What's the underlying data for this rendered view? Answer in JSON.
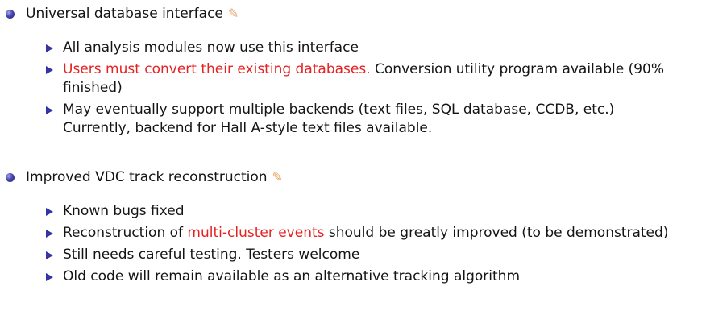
{
  "section1": {
    "title": "Universal database interface",
    "pencil_icon": "pencil-icon",
    "items": [
      {
        "text": "All analysis modules now use this interface"
      },
      {
        "red": "Users must convert their existing databases.",
        "rest": " Conversion utility program available (90% finished)"
      },
      {
        "text": "May eventually support multiple backends (text files, SQL database, CCDB, etc.) Currently, backend for Hall A-style text files available."
      }
    ]
  },
  "section2": {
    "title": "Improved VDC track reconstruction",
    "pencil_icon": "pencil-icon",
    "items": [
      {
        "text": "Known bugs fixed"
      },
      {
        "before": "Reconstruction of ",
        "red": "multi-cluster events",
        "after": " should be greatly improved (to be demonstrated)"
      },
      {
        "text": "Still needs careful testing. Testers welcome"
      },
      {
        "text": "Old code will remain available as an alternative tracking algorithm"
      }
    ]
  },
  "colors": {
    "text": "#141414",
    "highlight_red": "#e52222",
    "bullet_blue": "#3434a4",
    "pencil_orange": "#e8a468"
  }
}
